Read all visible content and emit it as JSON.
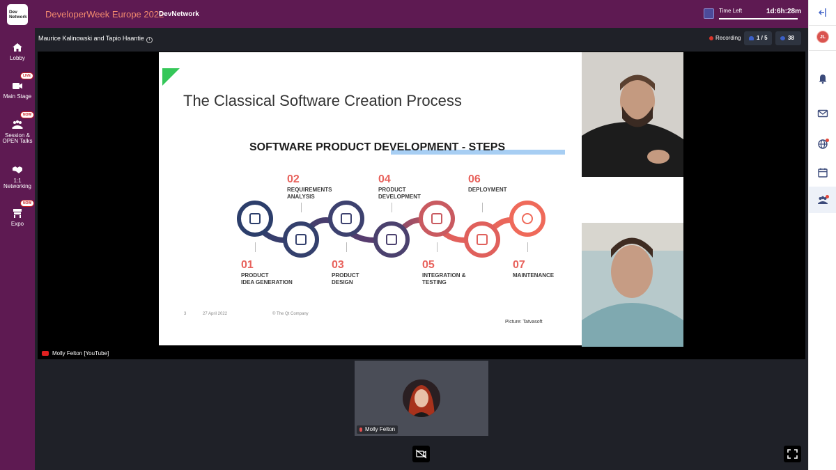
{
  "header": {
    "logo_text": "Dev Network",
    "event_title": "DeveloperWeek Europe 2022",
    "org": "DevNetwork",
    "time_left_label": "Time Left",
    "time_left_value": "1d:6h:28m",
    "time_left_progress": 0.98
  },
  "sidebar": {
    "items": [
      {
        "label": "Lobby",
        "icon": "home-icon",
        "badge": ""
      },
      {
        "label": "Main Stage",
        "icon": "video-camera-icon",
        "badge": "LIVE"
      },
      {
        "label": "Session & OPEN Talks",
        "icon": "people-group-icon",
        "badge": "NOW"
      },
      {
        "label": "1:1 Networking",
        "icon": "handshake-icon",
        "badge": ""
      },
      {
        "label": "Expo",
        "icon": "booth-icon",
        "badge": "NOW"
      }
    ]
  },
  "stage": {
    "speakers": "Maurice Kalinowski and Tapio Haantie",
    "recording_label": "Recording",
    "participants_count": "1 / 5",
    "viewers_count": "38",
    "source_label": "Molly Felton [YouTube]"
  },
  "slide": {
    "title": "The Classical Software Creation Process",
    "subtitle": "SOFTWARE PRODUCT DEVELOPMENT - STEPS",
    "steps": [
      {
        "num": "01",
        "label": "PRODUCT\nIDEA GENERATION"
      },
      {
        "num": "02",
        "label": "REQUIREMENTS\nANALYSIS"
      },
      {
        "num": "03",
        "label": "PRODUCT\nDESIGN"
      },
      {
        "num": "04",
        "label": "PRODUCT\nDEVELOPMENT"
      },
      {
        "num": "05",
        "label": "INTEGRATION &\nTESTING"
      },
      {
        "num": "06",
        "label": "DEPLOYMENT"
      },
      {
        "num": "07",
        "label": "MAINTENANCE"
      }
    ],
    "footer_page": "3",
    "footer_date": "27 April 2022",
    "footer_company": "© The Qt Company",
    "picture_credit": "Picture: Tatvasoft"
  },
  "participant": {
    "name": "Molly Felton"
  },
  "right_rail": {
    "avatar_initials": "JL",
    "icons": [
      "collapse-icon",
      "bell-icon",
      "mail-icon",
      "globe-icon",
      "calendar-icon",
      "people-icon"
    ]
  },
  "colors": {
    "brand_purple": "#5e1a52",
    "accent_orange": "#f28a6e",
    "stage_bg": "#1f2128"
  }
}
